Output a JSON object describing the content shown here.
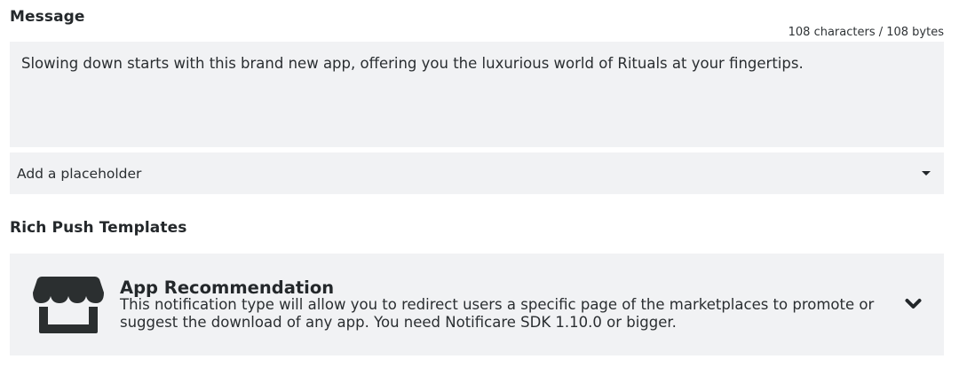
{
  "message": {
    "title": "Message",
    "counter": "108 characters / 108 bytes",
    "text": "Slowing down starts with this brand new app, offering you the luxurious world of Rituals at your fingertips."
  },
  "placeholder": {
    "label": "Add a placeholder",
    "icon": "caret-down-icon"
  },
  "rich_push": {
    "title": "Rich Push Templates",
    "template": {
      "icon": "store-icon",
      "name": "App Recommendation",
      "description": "This notification type will allow you to redirect users a specific page of the marketplaces to promote or suggest the download of any app. You need Notificare SDK 1.10.0 or bigger.",
      "expand_icon": "chevron-down-icon"
    }
  },
  "colors": {
    "field_background": "#f1f2f4",
    "text": "#222629"
  }
}
